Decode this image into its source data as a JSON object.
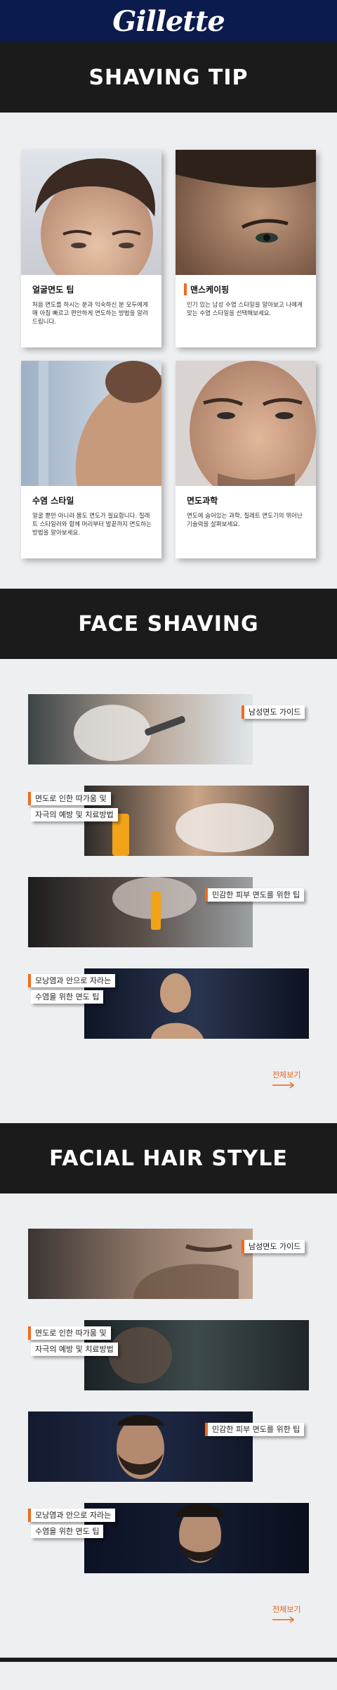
{
  "brand": {
    "logo_text": "Gillette",
    "bar_color": "#0b1b4d",
    "accent_color": "#f26b1d"
  },
  "shaving_tip": {
    "heading": "SHAVING TIP",
    "cards": [
      {
        "title": "얼굴면도 팁",
        "desc": "처음 면도를 하시는 분과 익숙하신 분 모두에게 매 아침 빠르고 편안하게 면도하는 방법을 알려 드립니다."
      },
      {
        "title": "맨스케이핑",
        "desc": "인기 있는 남성 수염 스타일을 알아보고 나에게 맞는 수염 스타일을 선택해보세요."
      },
      {
        "title": "수염 스타일",
        "desc": "얼굴 뿐만 아니라 몸도 면도가 필요합니다. 질레트 스타일러와 함께 머리부터 발끝까지 면도하는 방법을 알아보세요."
      },
      {
        "title": "면도과학",
        "desc": "면도에 숨어있는 과학, 질레트 면도기의 뛰어난 기술력을 살펴보세요."
      }
    ]
  },
  "face_shaving": {
    "heading": "FACE SHAVING",
    "items": [
      {
        "label_1": "남성면도 가이드"
      },
      {
        "label_1": "면도로 인한 따가움 및",
        "label_2": "자극의 예방 및 치료방법"
      },
      {
        "label_1": "민감한 피부 면도를 위한 팁"
      },
      {
        "label_1": "모낭염과 안으로 자라는",
        "label_2": "수염을 위한 면도 팁"
      }
    ],
    "more_label": "전체보기"
  },
  "facial_hair_style": {
    "heading": "FACIAL HAIR STYLE",
    "items": [
      {
        "label_1": "남성면도 가이드"
      },
      {
        "label_1": "면도로 인한 따가움 및",
        "label_2": "자극의 예방 및 치료방법"
      },
      {
        "label_1": "민감한 피부 면도를 위한 팁"
      },
      {
        "label_1": "모낭염과 안으로 자라는",
        "label_2": "수염을 위한 면도 팁"
      }
    ],
    "more_label": "전체보기"
  }
}
